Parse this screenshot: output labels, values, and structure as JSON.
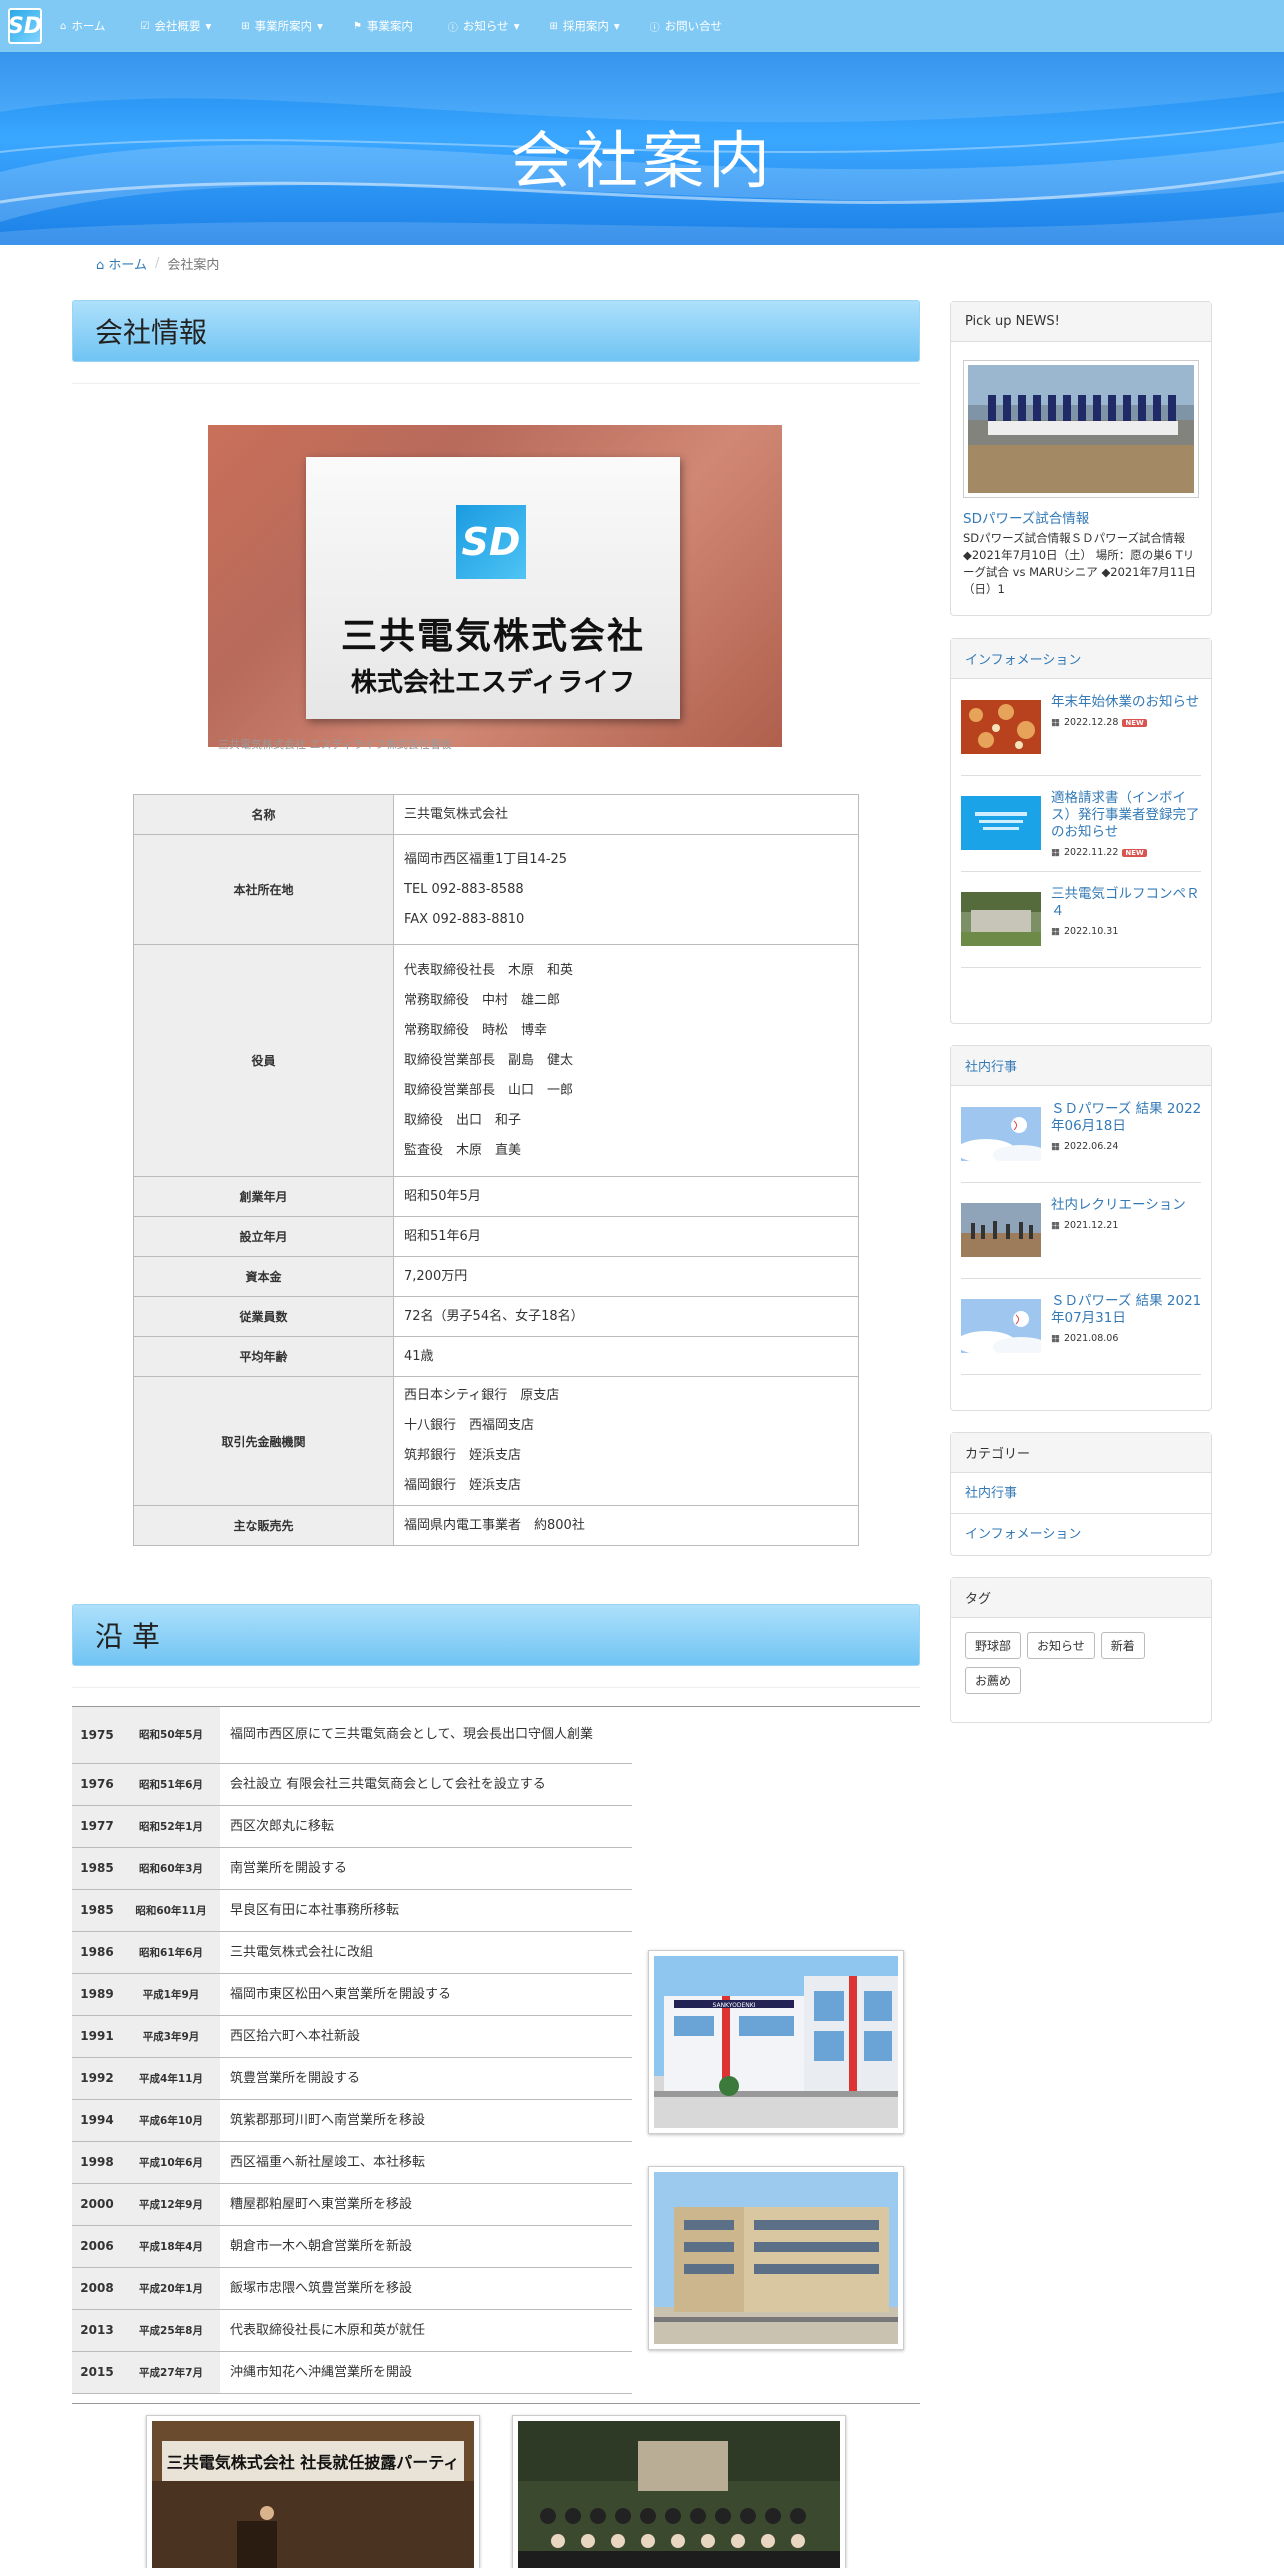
{
  "nav": {
    "items": [
      {
        "label": "ホーム",
        "icon": "home-icon",
        "caret": ""
      },
      {
        "label": "会社概要",
        "icon": "check-square-icon",
        "caret": "▾"
      },
      {
        "label": "事業所案内",
        "icon": "plus-square-icon",
        "caret": "▾"
      },
      {
        "label": "事業案内",
        "icon": "flag-icon",
        "caret": ""
      },
      {
        "label": "お知らせ",
        "icon": "info-circle-icon",
        "caret": "▾"
      },
      {
        "label": "採用案内",
        "icon": "plus-square-icon",
        "caret": "▾"
      },
      {
        "label": "お問い合せ",
        "icon": "info-circle-icon",
        "caret": ""
      }
    ]
  },
  "hero": {
    "title": "会社案内"
  },
  "breadcrumb": {
    "home": "ホーム",
    "current": "会社案内"
  },
  "company": {
    "heading": "会社情報",
    "plate": {
      "line1": "三共電気株式会社",
      "line2": "株式会社エスディライフ",
      "logo": "SD"
    },
    "caption": "三共電気株式会社 エスディライフ株式会社看板",
    "rows": [
      {
        "key": "名称",
        "values": [
          "三共電気株式会社"
        ]
      },
      {
        "key": "本社所在地",
        "values": [
          "福岡市西区福重1丁目14-25",
          "TEL 092-883-8588",
          "FAX 092-883-8810"
        ]
      },
      {
        "key": "役員",
        "values": [
          "代表取締役社長　木原　和英",
          "常務取締役　中村　雄二郎",
          "常務取締役　時松　博幸",
          "取締役営業部長　副島　健太",
          "取締役営業部長　山口　一郎",
          "取締役　出口　和子",
          "監査役　木原　直美"
        ]
      },
      {
        "key": "創業年月",
        "values": [
          "昭和50年5月"
        ]
      },
      {
        "key": "設立年月",
        "values": [
          "昭和51年6月"
        ]
      },
      {
        "key": "資本金",
        "values": [
          "7,200万円"
        ]
      },
      {
        "key": "従業員数",
        "values": [
          "72名（男子54名、女子18名）"
        ]
      },
      {
        "key": "平均年齢",
        "values": [
          "41歳"
        ]
      },
      {
        "key": "取引先金融機関",
        "values": [
          "西日本シティ銀行　原支店",
          "十八銀行　西福岡支店",
          "筑邦銀行　姪浜支店",
          "福岡銀行　姪浜支店"
        ]
      },
      {
        "key": "主な販売先",
        "values": [
          "福岡県内電工事業者　約800社"
        ]
      }
    ]
  },
  "history": {
    "heading": "沿 革",
    "rows": [
      {
        "year": "1975",
        "era": "昭和50年5月",
        "text": "福岡市西区原にて三共電気商会として、現会長出口守個人創業"
      },
      {
        "year": "1976",
        "era": "昭和51年6月",
        "text": "会社設立 有限会社三共電気商会として会社を設立する"
      },
      {
        "year": "1977",
        "era": "昭和52年1月",
        "text": "西区次郎丸に移転"
      },
      {
        "year": "1985",
        "era": "昭和60年3月",
        "text": "南営業所を開設する"
      },
      {
        "year": "1985",
        "era": "昭和60年11月",
        "text": "早良区有田に本社事務所移転"
      },
      {
        "year": "1986",
        "era": "昭和61年6月",
        "text": "三共電気株式会社に改組"
      },
      {
        "year": "1989",
        "era": "平成1年9月",
        "text": "福岡市東区松田へ東営業所を開設する"
      },
      {
        "year": "1991",
        "era": "平成3年9月",
        "text": "西区拾六町へ本社新設"
      },
      {
        "year": "1992",
        "era": "平成4年11月",
        "text": "筑豊営業所を開設する"
      },
      {
        "year": "1994",
        "era": "平成6年10月",
        "text": "筑紫郡那珂川町へ南営業所を移設"
      },
      {
        "year": "1998",
        "era": "平成10年6月",
        "text": "西区福重へ新社屋竣工、本社移転"
      },
      {
        "year": "2000",
        "era": "平成12年9月",
        "text": "糟屋郡粕屋町へ東営業所を移設"
      },
      {
        "year": "2006",
        "era": "平成18年4月",
        "text": "朝倉市一木へ朝倉営業所を新設"
      },
      {
        "year": "2008",
        "era": "平成20年1月",
        "text": "飯塚市忠隈へ筑豊営業所を移設"
      },
      {
        "year": "2013",
        "era": "平成25年8月",
        "text": "代表取締役社長に木原和英が就任"
      },
      {
        "year": "2015",
        "era": "平成27年7月",
        "text": "沖縄市知花へ沖縄営業所を開設"
      }
    ],
    "building1_sign": "SANKYODENKI",
    "party_banner": "三共電気株式会社 社長就任披露パーティ"
  },
  "sidebar": {
    "pickup": {
      "title": "Pick up NEWS!",
      "link": "SDパワーズ試合情報",
      "text": "SDパワーズ試合情報ＳＤパワーズ試合情報 ◆2021年7月10日（土） 場所：愿の巣6 Tリーグ試合 vs MARUシニア ◆2021年7月11日（日）1"
    },
    "info": {
      "title": "インフォメーション",
      "items": [
        {
          "title": "年末年始休業のお知らせ",
          "date": "2022.12.28",
          "new": "NEW"
        },
        {
          "title": "適格請求書（インボイス）発行事業者登録完了のお知らせ",
          "date": "2022.11.22",
          "new": "NEW"
        },
        {
          "title": "三共電気ゴルフコンペＲ４",
          "date": "2022.10.31",
          "new": ""
        }
      ]
    },
    "events": {
      "title": "社内行事",
      "items": [
        {
          "title": "ＳＤパワーズ 結果 2022年06月18日",
          "date": "2022.06.24"
        },
        {
          "title": "社内レクリエーション",
          "date": "2021.12.21"
        },
        {
          "title": "ＳＤパワーズ 結果 2021年07月31日",
          "date": "2021.08.06"
        }
      ]
    },
    "categories": {
      "title": "カテゴリー",
      "items": [
        "社内行事",
        "インフォメーション"
      ]
    },
    "tags": {
      "title": "タグ",
      "items": [
        "野球部",
        "お知らせ",
        "新着",
        "お薦め"
      ]
    }
  }
}
